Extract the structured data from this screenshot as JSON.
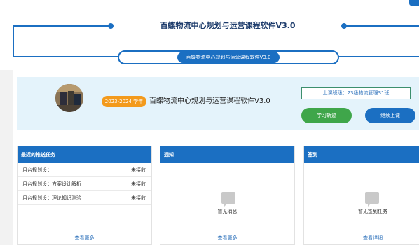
{
  "banner": {
    "title": "百蝶物流中心规划与运营课程软件V3.0",
    "pill_label": "百蝶物流中心规划与运营课程软件V3.0"
  },
  "course": {
    "year_badge": "2023-2024 学年",
    "title": "百蝶物流中心规划与运营课程软件V3.0",
    "class_label": "上课班级：23级物流管理S1班",
    "track_button": "学习轨迹",
    "continue_button": "继续上课"
  },
  "tasks": {
    "header": "最近的推送任务",
    "items": [
      {
        "name": "月台规划设计",
        "status": "未接收"
      },
      {
        "name": "月台规划设计方案设计解析",
        "status": "未接收"
      },
      {
        "name": "月台规划设计理论知识测验",
        "status": "未接收"
      }
    ],
    "more": "查看更多"
  },
  "notice": {
    "header": "通知",
    "empty": "暂无消息",
    "more": "查看更多"
  },
  "signin": {
    "header": "签到",
    "empty": "暂无签到任务",
    "more": "查看详细"
  },
  "colors": {
    "primary": "#1b6fc2",
    "badge": "#f39a1c",
    "green": "#3fa64a"
  }
}
